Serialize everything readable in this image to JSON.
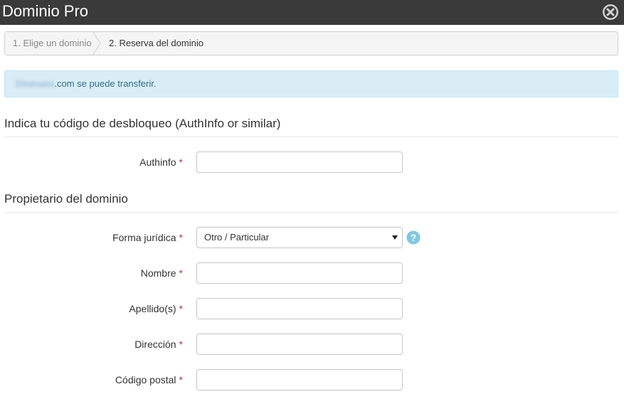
{
  "window": {
    "title": "Dominio Pro",
    "close_icon": "close-circle-icon"
  },
  "breadcrumb": {
    "step1": "1. Elige un dominio",
    "step2": "2. Reserva del dominio"
  },
  "alert": {
    "domain_name": "20minutos",
    "message": ".com se puede transferir."
  },
  "section_auth": {
    "title": "Indica tu código de desbloqueo (AuthInfo or similar)",
    "fields": {
      "authinfo": {
        "label": "Authinfo",
        "required": "*",
        "value": ""
      }
    }
  },
  "section_owner": {
    "title": "Propietario del dominio",
    "fields": {
      "forma_juridica": {
        "label": "Forma jurídica",
        "required": "*",
        "selected": "Otro / Particular"
      },
      "nombre": {
        "label": "Nombre",
        "required": "*",
        "value": ""
      },
      "apellidos": {
        "label": "Apellido(s)",
        "required": "*",
        "value": ""
      },
      "direccion": {
        "label": "Dirección",
        "required": "*",
        "value": ""
      },
      "codigo_postal": {
        "label": "Código postal",
        "required": "*",
        "value": ""
      }
    }
  },
  "colors": {
    "titlebar": "#3a3a3a",
    "alert_bg": "#d9edf7",
    "alert_text": "#31708f",
    "required": "#c9302c",
    "help": "#7ec8e3"
  }
}
